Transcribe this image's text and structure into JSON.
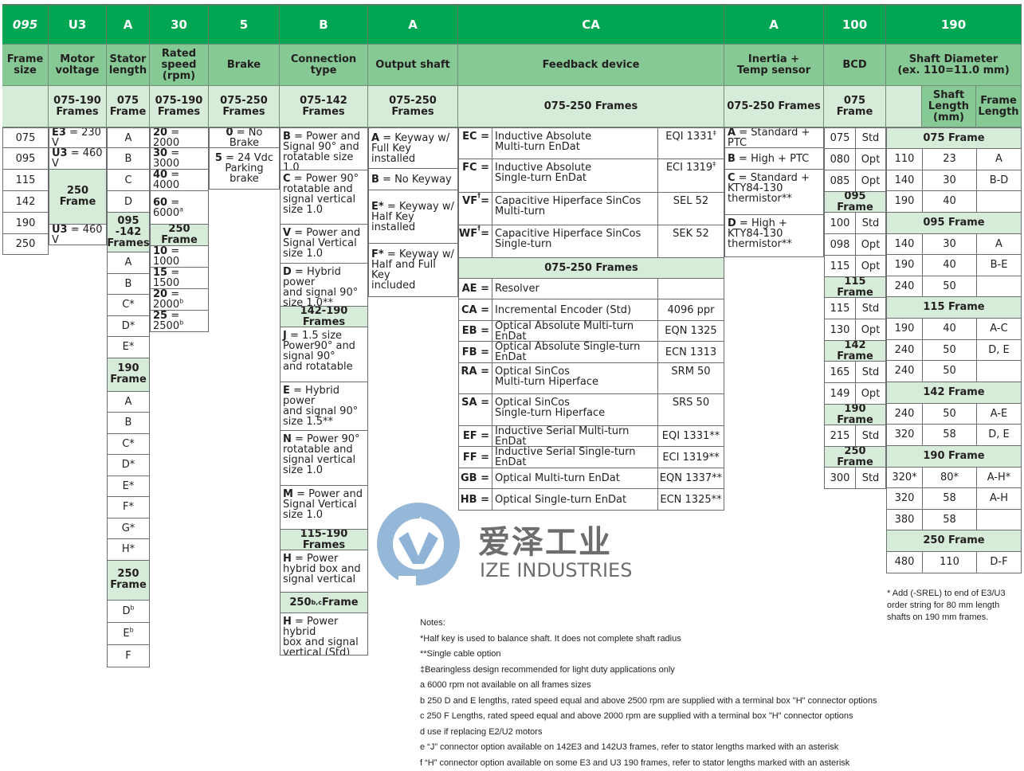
{
  "columns": [
    {
      "code": "095",
      "title": "Frame\nsize",
      "sub": ""
    },
    {
      "code": "U3",
      "title": "Motor\nvoltage",
      "sub": "075-190\nFrames"
    },
    {
      "code": "A",
      "title": "Stator\nlength",
      "sub": "075\nFrame"
    },
    {
      "code": "30",
      "title": "Rated\nspeed\n(rpm)",
      "sub": "075-190\nFrames"
    },
    {
      "code": "5",
      "title": "Brake",
      "sub": "075-250\nFrames"
    },
    {
      "code": "B",
      "title": "Connection\ntype",
      "sub": "075-142\nFrames"
    },
    {
      "code": "A",
      "title": "Output shaft",
      "sub": "075-250\nFrames"
    },
    {
      "code": "CA",
      "title": "Feedback device",
      "sub": "075-250 Frames"
    },
    {
      "code": "A",
      "title": "Inertia +\nTemp sensor",
      "sub": "075-250 Frames"
    },
    {
      "code": "100",
      "title": "BCD",
      "sub": "075 Frame"
    },
    {
      "code": "190",
      "title": "Shaft Diameter\n(ex. 110=11.0 mm)",
      "sub": ""
    }
  ],
  "frame_size": [
    "075",
    "095",
    "115",
    "142",
    "190",
    "250"
  ],
  "motor_voltage": {
    "rows": [
      {
        "code": "E3",
        "value": "= 230 V"
      },
      {
        "code": "U3",
        "value": "= 460 V"
      }
    ],
    "group_250": "250\nFrame",
    "row_250": {
      "code": "U3",
      "value": "= 460 V"
    }
  },
  "stator_length": {
    "g075": [
      "A",
      "B",
      "C",
      "D"
    ],
    "g095_label": "095\n-142\nFrames",
    "g095": [
      "A",
      "B",
      "C*",
      "D*",
      "E*"
    ],
    "g190_label": "190\nFrame",
    "g190": [
      "A",
      "B",
      "C*",
      "D*",
      "E*",
      "F*",
      "G*",
      "H*"
    ],
    "g250_label": "250\nFrame",
    "g250": [
      {
        "v": "D",
        "sup": "b"
      },
      {
        "v": "E",
        "sup": "b"
      },
      {
        "v": "F",
        "sup": ""
      }
    ]
  },
  "rated_speed": {
    "g075": [
      {
        "code": "20",
        "value": "= 2000",
        "sup": ""
      },
      {
        "code": "30",
        "value": "= 3000",
        "sup": ""
      },
      {
        "code": "40",
        "value": "= 4000",
        "sup": ""
      },
      {
        "code": "60",
        "value": "= 6000",
        "sup": "a"
      }
    ],
    "g250_label": "250 Frame",
    "g250": [
      {
        "code": "10",
        "value": "= 1000",
        "sup": ""
      },
      {
        "code": "15",
        "value": "= 1500",
        "sup": ""
      },
      {
        "code": "20",
        "value": "= 2000",
        "sup": "b"
      },
      {
        "code": "25",
        "value": "= 2500",
        "sup": "b"
      }
    ]
  },
  "brake": [
    {
      "code": "0",
      "value": "= No Brake",
      "extra": ""
    },
    {
      "code": "5",
      "value": "= 24 Vdc",
      "extra": "Parking brake"
    }
  ],
  "connection": {
    "g075": [
      {
        "code": "B",
        "text": "= Power and\nSignal 90° and\nrotatable size 1.0"
      },
      {
        "code": "C",
        "text": "= Power 90°\nrotatable and\nsignal vertical\nsize 1.0"
      },
      {
        "code": "V",
        "text": "= Power and\nSignal Vertical\nsize 1.0"
      },
      {
        "code": "D",
        "text": "= Hybrid power\nand signal 90°\nsize 1.0**"
      }
    ],
    "g142_label": "142-190 Frames",
    "g142": [
      {
        "code": "J",
        "text": "= 1.5 size\nPower90° and\nsignal 90°\nand rotatable"
      },
      {
        "code": "E",
        "text": "= Hybrid power\nand signal 90°\nsize 1.5**"
      },
      {
        "code": "N",
        "text": "= Power 90°\nrotatable and\nsignal vertical\nsize 1.0"
      },
      {
        "code": "M",
        "text": "= Power and\nSignal Vertical\nsize 1.0"
      }
    ],
    "g115_label": "115-190 Frames",
    "g115": [
      {
        "code": "H",
        "text": "= Power\nhybrid box and\nsignal vertical"
      }
    ],
    "g250_label_pre": "250",
    "g250_label_sup": "b,c",
    "g250_label_post": " Frame",
    "g250": [
      {
        "code": "H",
        "text": "= Power hybrid\nbox and signal\nvertical (Std)"
      }
    ]
  },
  "output_shaft": [
    {
      "code": "A",
      "text": "= Keyway w/\nFull Key installed"
    },
    {
      "code": "B",
      "text": "= No Keyway"
    },
    {
      "code": "E*",
      "text": "= Keyway w/\nHalf Key installed"
    },
    {
      "code": "F*",
      "text": "= Keyway w/\nHalf and Full Key\nincluded"
    }
  ],
  "feedback": {
    "g1": [
      {
        "code": "EC",
        "sup": "",
        "desc": "Inductive Absolute\nMulti-turn EnDat",
        "model": "EQI 1331",
        "model_sup": "‡"
      },
      {
        "code": "FC",
        "sup": "",
        "desc": "Inductive Absolute\nSingle-turn EnDat",
        "model": "ECI 1319",
        "model_sup": "‡"
      },
      {
        "code": "VF",
        "sup": "†",
        "desc": "Capacitive Hiperface SinCos\nMulti-turn",
        "model": "SEL 52",
        "model_sup": ""
      },
      {
        "code": "WF",
        "sup": "†",
        "desc": "Capacitive Hiperface SinCos\nSingle-turn",
        "model": "SEK 52",
        "model_sup": ""
      }
    ],
    "g2_label": "075-250 Frames",
    "g2": [
      {
        "code": "AE",
        "sup": "",
        "desc": "Resolver",
        "model": "",
        "model_sup": ""
      },
      {
        "code": "CA",
        "sup": "",
        "desc": "Incremental Encoder (Std)",
        "model": "4096 ppr",
        "model_sup": ""
      },
      {
        "code": "EB",
        "sup": "",
        "desc": "Optical Absolute Multi-turn EnDat",
        "model": "EQN 1325",
        "model_sup": ""
      },
      {
        "code": "FB",
        "sup": "",
        "desc": "Optical Absolute Single-turn EnDat",
        "model": "ECN 1313",
        "model_sup": ""
      },
      {
        "code": "RA",
        "sup": "",
        "desc": "Optical SinCos\nMulti-turn Hiperface",
        "model": "SRM 50",
        "model_sup": ""
      },
      {
        "code": "SA",
        "sup": "",
        "desc": "Optical SinCos\nSingle-turn Hiperface",
        "model": "SRS 50",
        "model_sup": ""
      },
      {
        "code": "EF",
        "sup": "",
        "desc": "Inductive Serial Multi-turn EnDat",
        "model": "EQI 1331**",
        "model_sup": ""
      },
      {
        "code": "FF",
        "sup": "",
        "desc": "Inductive Serial Single-turn EnDat",
        "model": "ECI 1319**",
        "model_sup": ""
      },
      {
        "code": "GB",
        "sup": "",
        "desc": "Optical Multi-turn EnDat",
        "model": "EQN 1337**",
        "model_sup": ""
      },
      {
        "code": "HB",
        "sup": "",
        "desc": "Optical Single-turn EnDat",
        "model": "ECN 1325**",
        "model_sup": ""
      }
    ]
  },
  "inertia": [
    {
      "code": "A",
      "text": "= Standard + PTC"
    },
    {
      "code": "B",
      "text": "= High + PTC"
    },
    {
      "code": "C",
      "text": "= Standard +\nKTY84-130\nthermistor**"
    },
    {
      "code": "D",
      "text": "= High +\nKTY84-130\nthermistor**"
    }
  ],
  "bcd": {
    "groups": [
      {
        "label": "075 Frame",
        "rows": [
          [
            "075",
            "Std"
          ],
          [
            "080",
            "Opt"
          ],
          [
            "085",
            "Opt"
          ]
        ]
      },
      {
        "label": "095 Frame",
        "rows": [
          [
            "100",
            "Std"
          ],
          [
            "098",
            "Opt"
          ],
          [
            "115",
            "Opt"
          ]
        ]
      },
      {
        "label": "115 Frame",
        "rows": [
          [
            "115",
            "Std"
          ],
          [
            "130",
            "Opt"
          ]
        ]
      },
      {
        "label": "142 Frame",
        "rows": [
          [
            "165",
            "Std"
          ],
          [
            "149",
            "Opt"
          ]
        ]
      },
      {
        "label": "190 Frame",
        "rows": [
          [
            "215",
            "Std"
          ]
        ]
      },
      {
        "label": "250 Frame",
        "rows": [
          [
            "300",
            "Std"
          ]
        ]
      }
    ]
  },
  "shaft": {
    "sub_headers": [
      "",
      "Shaft\nLength\n(mm)",
      "Frame\nLength"
    ],
    "groups": [
      {
        "label": "075 Frame",
        "rows": [
          [
            "110",
            "23",
            "A"
          ],
          [
            "140",
            "30",
            "B-D"
          ],
          [
            "190",
            "40",
            ""
          ]
        ]
      },
      {
        "label": "095 Frame",
        "rows": [
          [
            "140",
            "30",
            "A"
          ],
          [
            "190",
            "40",
            "B-E"
          ],
          [
            "240",
            "50",
            ""
          ]
        ]
      },
      {
        "label": "115 Frame",
        "rows": [
          [
            "190",
            "40",
            "A-C"
          ],
          [
            "240",
            "50",
            "D, E"
          ],
          [
            "240",
            "50",
            ""
          ]
        ]
      },
      {
        "label": "142 Frame",
        "rows": [
          [
            "240",
            "50",
            "A-E"
          ],
          [
            "320",
            "58",
            "D, E"
          ]
        ]
      },
      {
        "label": "190 Frame",
        "rows": [
          [
            "320*",
            "80*",
            "A-H*"
          ],
          [
            "320",
            "58",
            "A-H"
          ],
          [
            "380",
            "58",
            ""
          ]
        ]
      },
      {
        "label": "250 Frame",
        "rows": [
          [
            "480",
            "110",
            "D-F"
          ]
        ]
      }
    ],
    "footnote": "* Add (-SREL) to end of E3/U3\norder string for 80 mm length\nshafts on 190 mm frames."
  },
  "notes": {
    "title": "Notes:",
    "items": [
      "*Half key is used to balance shaft. It does not complete shaft radius",
      "**Single cable option",
      "‡Bearingless design recommended for light duty applications only",
      "a 6000 rpm not available on all frames sizes",
      "b 250 D and E lengths, rated speed equal and above 2500 rpm are supplied with a terminal box \"H\" connector options",
      "c 250 F Lengths, rated speed equal and above 2000 rpm are supplied with a terminal box \"H\" connector options",
      "d use if replacing E2/U2 motors",
      "e “J” connector option available on 142E3 and 142U3 frames, refer to stator lengths marked with an asterisk",
      "f “H” connector option available on some E3 and U3 190 frames, refer to stator lengths marked with an asterisk"
    ]
  },
  "watermark": {
    "cn": "爱泽工业",
    "en": "IZE INDUSTRIES"
  },
  "colors": {
    "header_green": "#00a651",
    "title_green": "#86c995",
    "sub_green": "#d6ecd9",
    "watermark_blue": "#8fb3d6"
  }
}
